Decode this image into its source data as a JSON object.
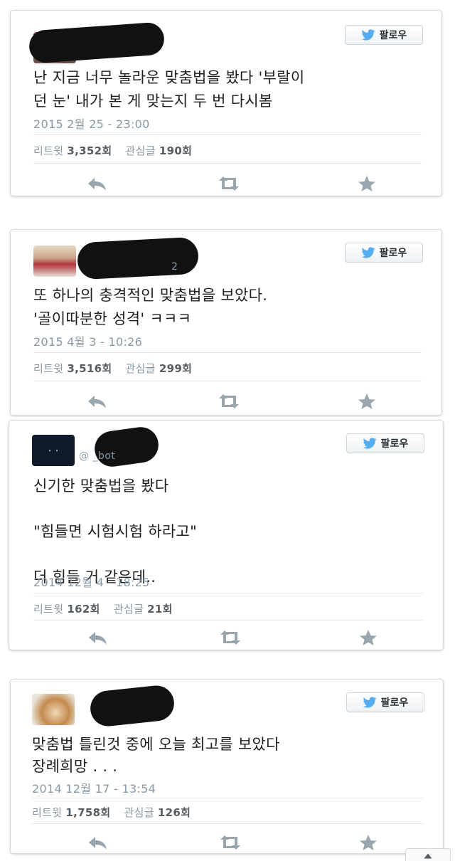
{
  "colors": {
    "bird": "#55acee",
    "action_icon": "#9aa6ae",
    "border": "#d6d9db"
  },
  "icons": {
    "follow": "twitter-bird-icon",
    "reply": "reply-arrow-icon",
    "retweet": "retweet-icon",
    "favorite": "star-icon",
    "scroll_top": "caret-up-icon"
  },
  "tweets": [
    {
      "follow_label": "팔로우",
      "handle": "",
      "text_lines": [
        "난 지금 너무 놀라운 맞춤법을 봤다 '부랄이",
        "던 눈' 내가 본 게 맞는지 두 번 다시봄"
      ],
      "date": "2015 2월 25 - 23:00",
      "retweet_label": "리트윗",
      "retweet_count": "3,352회",
      "favorite_label": "관심글",
      "favorite_count": "190회"
    },
    {
      "follow_label": "팔로우",
      "handle": "2",
      "text_lines": [
        "또 하나의 충격적인 맞춤법을 보았다.",
        "'골이따분한 성격' ㅋㅋㅋ"
      ],
      "date": "2015 4월 3 - 10:26",
      "retweet_label": "리트윗",
      "retweet_count": "3,516회",
      "favorite_label": "관심글",
      "favorite_count": "299회"
    },
    {
      "follow_label": "팔로우",
      "handle": "@        _bot",
      "text_lines": [
        "신기한 맞춤법을 봤다",
        "",
        "\"힘들면 시험시험 하라고\"",
        "",
        "더 힘들 거 같은데.."
      ],
      "date": "2014 12월 4 - 18:25",
      "retweet_label": "리트윗",
      "retweet_count": "162회",
      "favorite_label": "관심글",
      "favorite_count": "21회"
    },
    {
      "follow_label": "팔로우",
      "handle": "",
      "text_lines": [
        "맞춤법 틀린것 중에 오늘 최고를  보았다",
        "장례희망 . . ."
      ],
      "date": "2014 12월 17 - 13:54",
      "retweet_label": "리트윗",
      "retweet_count": "1,758회",
      "favorite_label": "관심글",
      "favorite_count": "126회"
    }
  ]
}
